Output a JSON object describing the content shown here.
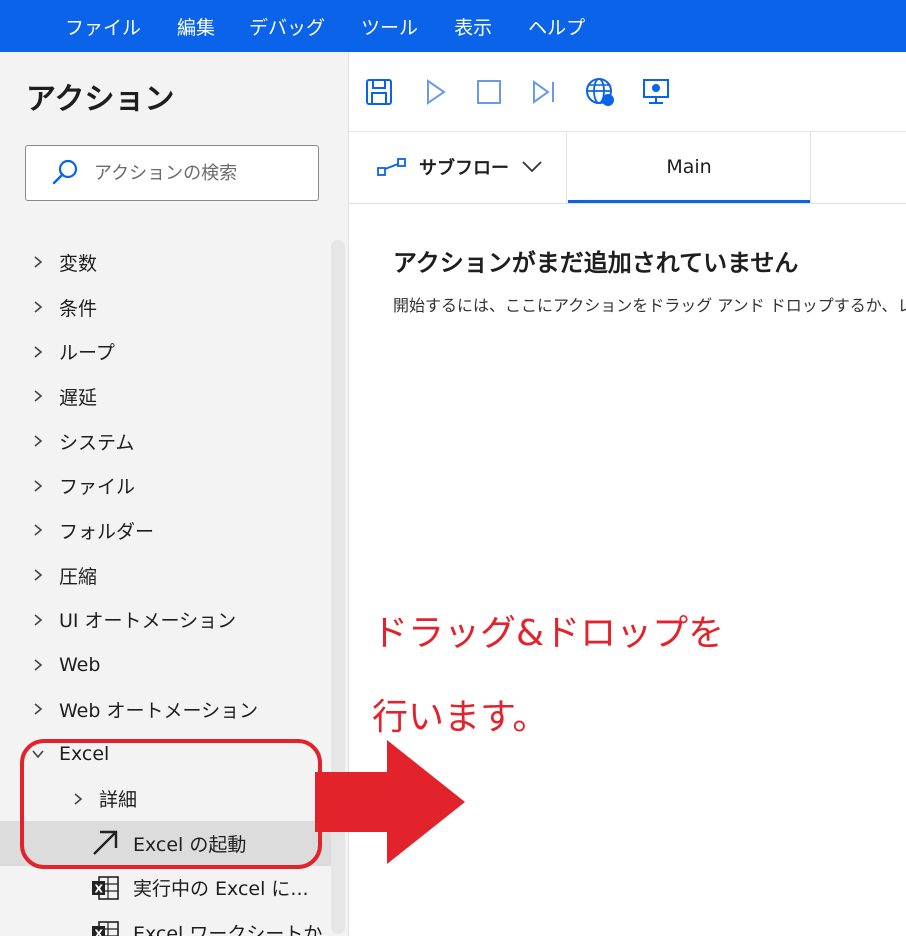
{
  "menubar": {
    "items": [
      "ファイル",
      "編集",
      "デバッグ",
      "ツール",
      "表示",
      "ヘルプ"
    ]
  },
  "sidebar": {
    "title": "アクション",
    "search": {
      "placeholder": "アクションの検索",
      "icon": "search-icon"
    },
    "groups": [
      {
        "label": "変数",
        "expanded": false
      },
      {
        "label": "条件",
        "expanded": false
      },
      {
        "label": "ループ",
        "expanded": false
      },
      {
        "label": "遅延",
        "expanded": false
      },
      {
        "label": "システム",
        "expanded": false
      },
      {
        "label": "ファイル",
        "expanded": false
      },
      {
        "label": "フォルダー",
        "expanded": false
      },
      {
        "label": "圧縮",
        "expanded": false
      },
      {
        "label": "UI オートメーション",
        "expanded": false
      },
      {
        "label": "Web",
        "expanded": false
      },
      {
        "label": "Web オートメーション",
        "expanded": false
      },
      {
        "label": "Excel",
        "expanded": true
      }
    ],
    "excel": {
      "subgroup": "詳細",
      "actions": [
        {
          "label": "Excel の起動",
          "icon": "launch-arrow-icon",
          "selected": true
        },
        {
          "label": "実行中の Excel に...",
          "icon": "excel-icon",
          "selected": false
        },
        {
          "label": "Excel ワークシートか...",
          "icon": "excel-icon",
          "selected": false
        }
      ]
    }
  },
  "toolbar": {
    "buttons": [
      "save-icon",
      "run-icon",
      "stop-icon",
      "step-icon",
      "web-recorder-icon",
      "desktop-recorder-icon"
    ]
  },
  "tabs": {
    "subflow_label": "サブフロー",
    "main_label": "Main"
  },
  "canvas": {
    "empty_title": "アクションがまだ追加されていません",
    "empty_desc": "開始するには、ここにアクションをドラッグ アンド ドロップするか、レ"
  },
  "annotation": {
    "line1": "ドラッグ&ドロップを",
    "line2": "行います。",
    "color": "#e3232b"
  },
  "colors": {
    "accent": "#0a63e8",
    "sidebar_bg": "#f3f3f3",
    "annotation": "#e3232b"
  }
}
